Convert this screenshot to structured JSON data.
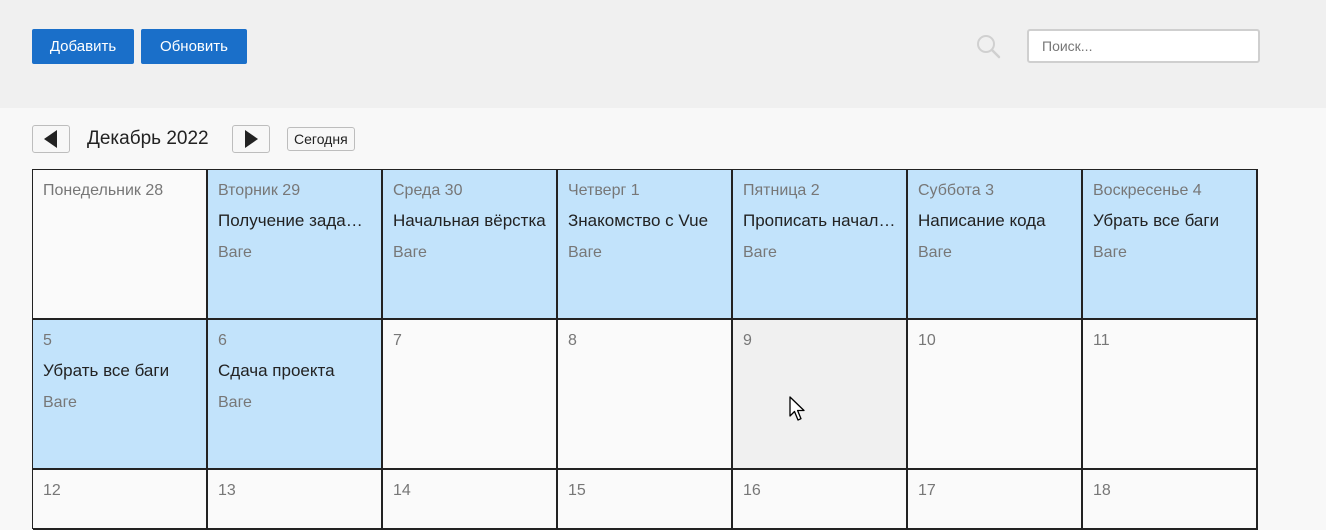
{
  "toolbar": {
    "add_label": "Добавить",
    "refresh_label": "Обновить"
  },
  "search": {
    "placeholder": "Поиск...",
    "value": "",
    "icon": "search-icon"
  },
  "calendar": {
    "month_title": "Декабрь 2022",
    "today_label": "Сегодня",
    "prev_icon": "triangle-left-icon",
    "next_icon": "triangle-right-icon",
    "week1": [
      {
        "day": "Понедельник 28",
        "title": "",
        "meta": ""
      },
      {
        "day": "Вторник 29",
        "title": "Получение задания",
        "meta": "Ваге"
      },
      {
        "day": "Среда 30",
        "title": "Начальная вёрстка",
        "meta": "Ваге"
      },
      {
        "day": "Четверг 1",
        "title": "Знакомство с Vue",
        "meta": "Ваге"
      },
      {
        "day": "Пятница 2",
        "title": "Прописать начальный код",
        "meta": "Ваге"
      },
      {
        "day": "Суббота 3",
        "title": "Написание кода",
        "meta": "Ваге"
      },
      {
        "day": "Воскресенье 4",
        "title": "Убрать все баги",
        "meta": "Ваге"
      }
    ],
    "week2": [
      {
        "day": "5",
        "title": "Убрать все баги",
        "meta": "Ваге"
      },
      {
        "day": "6",
        "title": "Сдача проекта",
        "meta": "Ваге"
      },
      {
        "day": "7",
        "title": "",
        "meta": ""
      },
      {
        "day": "8",
        "title": "",
        "meta": ""
      },
      {
        "day": "9",
        "title": "",
        "meta": ""
      },
      {
        "day": "10",
        "title": "",
        "meta": ""
      },
      {
        "day": "11",
        "title": "",
        "meta": ""
      }
    ],
    "week3": [
      {
        "day": "12"
      },
      {
        "day": "13"
      },
      {
        "day": "14"
      },
      {
        "day": "15"
      },
      {
        "day": "16"
      },
      {
        "day": "17"
      },
      {
        "day": "18"
      }
    ]
  },
  "colors": {
    "accent": "#1a6fc9",
    "event_bg": "#c2e3fb"
  }
}
